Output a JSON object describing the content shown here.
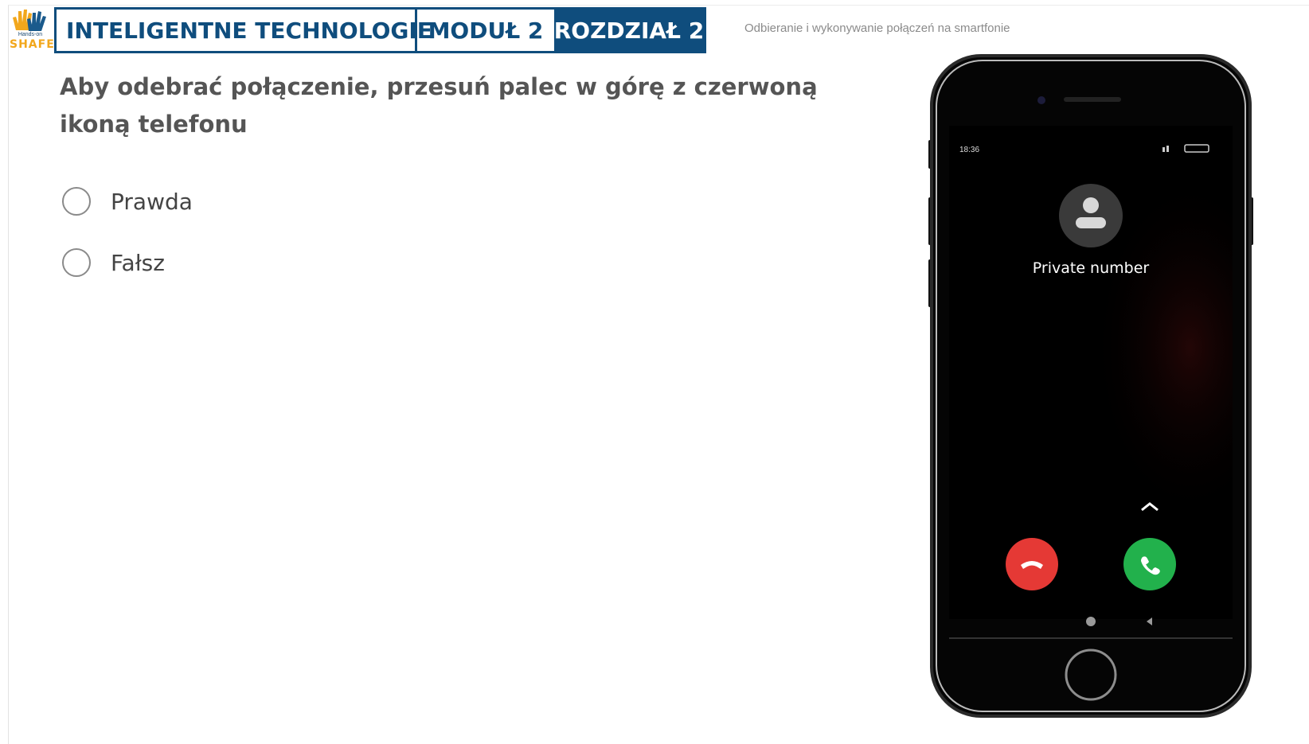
{
  "header": {
    "logo_small": "Hands-on",
    "logo_text": "SHAFE",
    "course_title": "INTELIGENTNE TECHNOLOGIE",
    "module": "MODUŁ 2",
    "chapter": "ROZDZIAŁ 2",
    "subtitle": "Odbieranie i wykonywanie połączeń na smartfonie"
  },
  "quiz": {
    "question": "Aby odebrać połączenie, przesuń palec w górę z czerwoną ikoną telefonu",
    "options": [
      {
        "label": "Prawda",
        "selected": false
      },
      {
        "label": "Fałsz",
        "selected": false
      }
    ]
  },
  "phone": {
    "status_time": "18:36",
    "caller": "Private number",
    "decline_color": "#e53935",
    "accept_color": "#22b14c",
    "icons": [
      "avatar-icon",
      "swipe-up-chevron-icon",
      "decline-call-icon",
      "accept-call-icon",
      "home-nav-icon",
      "back-nav-icon"
    ]
  },
  "colors": {
    "brand_blue": "#0f4d7d",
    "logo_orange": "#f2a71c"
  }
}
